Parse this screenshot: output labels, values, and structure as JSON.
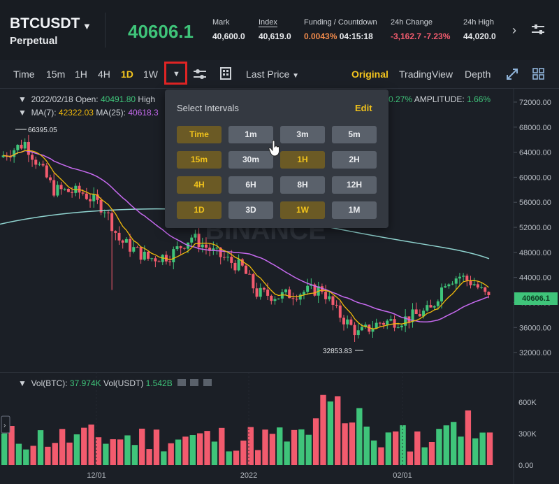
{
  "header": {
    "symbol": "BTCUSDT",
    "subtitle": "Perpetual",
    "price": "40606.1",
    "stats": [
      {
        "label": "Mark",
        "value": "40,600.0"
      },
      {
        "label": "Index",
        "value": "40,619.0"
      },
      {
        "label": "Funding / Countdown",
        "value_a": "0.0043%",
        "value_b": "04:15:18"
      },
      {
        "label": "24h Change",
        "value": "-3,162.7 -7.23%"
      },
      {
        "label": "24h High",
        "value": "44,020.0"
      }
    ]
  },
  "toolbar": {
    "intervals": [
      "Time",
      "15m",
      "1H",
      "4H",
      "1D",
      "1W"
    ],
    "active_interval": "1D",
    "last_price": "Last Price",
    "views": [
      "Original",
      "TradingView",
      "Depth"
    ],
    "active_view": "Original"
  },
  "chart_info": {
    "date_open": "2022/02/18  Open:",
    "open_value": "40491.80",
    "high_label": "High",
    "ma7_label": "MA(7):",
    "ma7_value": "42322.03",
    "ma25_label": "MA(25):",
    "ma25_value": "40618.3",
    "change_tail": "0.27%",
    "amplitude_label": "AMPLITUDE:",
    "amplitude_value": "1.66%",
    "high_marker": "66395.05",
    "low_marker": "32853.83",
    "watermark": "BINANCE",
    "last_price_tag": "40606.1"
  },
  "popup": {
    "title": "Select Intervals",
    "edit": "Edit",
    "intervals": [
      {
        "label": "Time",
        "selected": true
      },
      {
        "label": "1m",
        "selected": false
      },
      {
        "label": "3m",
        "selected": false
      },
      {
        "label": "5m",
        "selected": false
      },
      {
        "label": "15m",
        "selected": true
      },
      {
        "label": "30m",
        "selected": false
      },
      {
        "label": "1H",
        "selected": true
      },
      {
        "label": "2H",
        "selected": false
      },
      {
        "label": "4H",
        "selected": true
      },
      {
        "label": "6H",
        "selected": false
      },
      {
        "label": "8H",
        "selected": false
      },
      {
        "label": "12H",
        "selected": false
      },
      {
        "label": "1D",
        "selected": true
      },
      {
        "label": "3D",
        "selected": false
      },
      {
        "label": "1W",
        "selected": true
      },
      {
        "label": "1M",
        "selected": false
      }
    ]
  },
  "volume": {
    "label": "Vol(BTC):",
    "btc": "37.974K",
    "label2": "Vol(USDT)",
    "usdt": "1.542B"
  },
  "chart_data": [
    {
      "type": "candlestick",
      "title": "",
      "y_ticks": [
        "72000.00",
        "68000.00",
        "64000.00",
        "60000.00",
        "56000.00",
        "52000.00",
        "48000.00",
        "44000.00",
        "40000.00",
        "36000.00",
        "32000.00"
      ],
      "ylim": [
        30000,
        73000
      ],
      "x_ticks": [
        "12/01",
        "2022",
        "02/01"
      ],
      "high_marker": 66395.05,
      "low_marker": 32853.83,
      "series": [
        {
          "name": "MA(7)",
          "color": "#f0b90b"
        },
        {
          "name": "MA(25)",
          "color": "#c76af0"
        }
      ]
    },
    {
      "type": "bar",
      "title": "",
      "y_ticks": [
        "600K",
        "300K",
        "0.00"
      ],
      "ylim": [
        0,
        800
      ]
    }
  ],
  "colors": {
    "up": "#3fc47a",
    "down": "#f25b6e",
    "accent": "#f0b90b",
    "ma99": "#8fd3cf"
  }
}
